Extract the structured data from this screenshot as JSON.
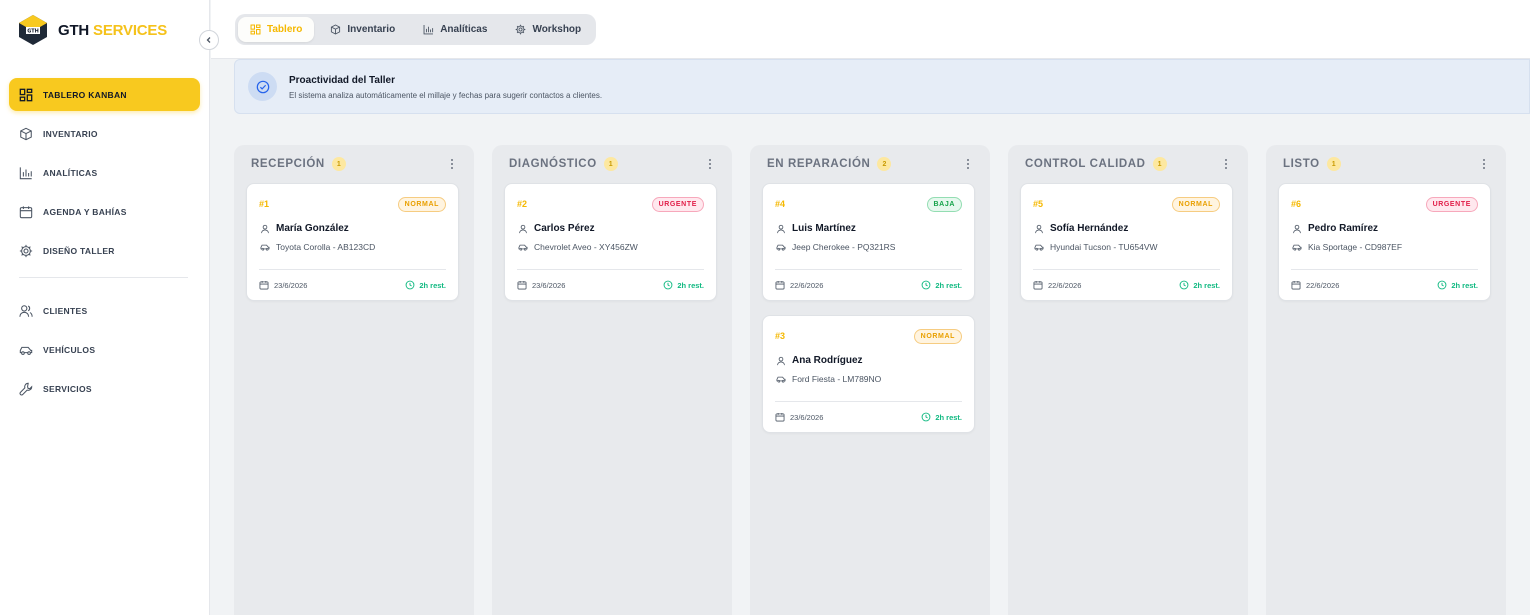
{
  "brand": {
    "part1": "GTH",
    "part2": "SERVICES"
  },
  "sidebar": {
    "items": [
      {
        "label": "TABLERO KANBAN",
        "icon": "layout-grid-icon",
        "active": true
      },
      {
        "label": "INVENTARIO",
        "icon": "box-icon"
      },
      {
        "label": "ANALÍTICAS",
        "icon": "bar-chart-icon"
      },
      {
        "label": "AGENDA Y BAHÍAS",
        "icon": "calendar-icon"
      },
      {
        "label": "DISEÑO TALLER",
        "icon": "gear-icon"
      },
      {
        "label": "CLIENTES",
        "icon": "users-icon"
      },
      {
        "label": "VEHÍCULOS",
        "icon": "car-icon"
      },
      {
        "label": "SERVICIOS",
        "icon": "wrench-icon"
      }
    ]
  },
  "tabs": [
    {
      "label": "Tablero",
      "icon": "layout-grid-icon",
      "active": true
    },
    {
      "label": "Inventario",
      "icon": "box-icon"
    },
    {
      "label": "Analíticas",
      "icon": "bar-chart-icon"
    },
    {
      "label": "Workshop",
      "icon": "gear-icon"
    }
  ],
  "banner": {
    "title": "Proactividad del Taller",
    "subtitle": "El sistema analiza automáticamente el millaje y fechas para sugerir contactos a clientes."
  },
  "columns": [
    {
      "title": "RECEPCIÓN",
      "count": "1",
      "cards": [
        {
          "id": "#1",
          "priority": "NORMAL",
          "name": "María González",
          "vehicle": "Toyota Corolla - AB123CD",
          "date": "23/6/2026",
          "time": "2h rest."
        }
      ]
    },
    {
      "title": "DIAGNÓSTICO",
      "count": "1",
      "cards": [
        {
          "id": "#2",
          "priority": "URGENTE",
          "name": "Carlos Pérez",
          "vehicle": "Chevrolet Aveo - XY456ZW",
          "date": "23/6/2026",
          "time": "2h rest."
        }
      ]
    },
    {
      "title": "EN REPARACIÓN",
      "count": "2",
      "cards": [
        {
          "id": "#4",
          "priority": "BAJA",
          "name": "Luis Martínez",
          "vehicle": "Jeep Cherokee - PQ321RS",
          "date": "22/6/2026",
          "time": "2h rest."
        },
        {
          "id": "#3",
          "priority": "NORMAL",
          "name": "Ana Rodríguez",
          "vehicle": "Ford Fiesta - LM789NO",
          "date": "23/6/2026",
          "time": "2h rest."
        }
      ]
    },
    {
      "title": "CONTROL CALIDAD",
      "count": "1",
      "cards": [
        {
          "id": "#5",
          "priority": "NORMAL",
          "name": "Sofía Hernández",
          "vehicle": "Hyundai Tucson - TU654VW",
          "date": "22/6/2026",
          "time": "2h rest."
        }
      ]
    },
    {
      "title": "LISTO",
      "count": "1",
      "cards": [
        {
          "id": "#6",
          "priority": "URGENTE",
          "name": "Pedro Ramírez",
          "vehicle": "Kia Sportage - CD987EF",
          "date": "22/6/2026",
          "time": "2h rest."
        }
      ]
    }
  ],
  "colors": {
    "accent": "#f8c91f",
    "normal": "#e9a000",
    "urgente": "#e11d48",
    "baja": "#16a34a",
    "time": "#10b981"
  }
}
